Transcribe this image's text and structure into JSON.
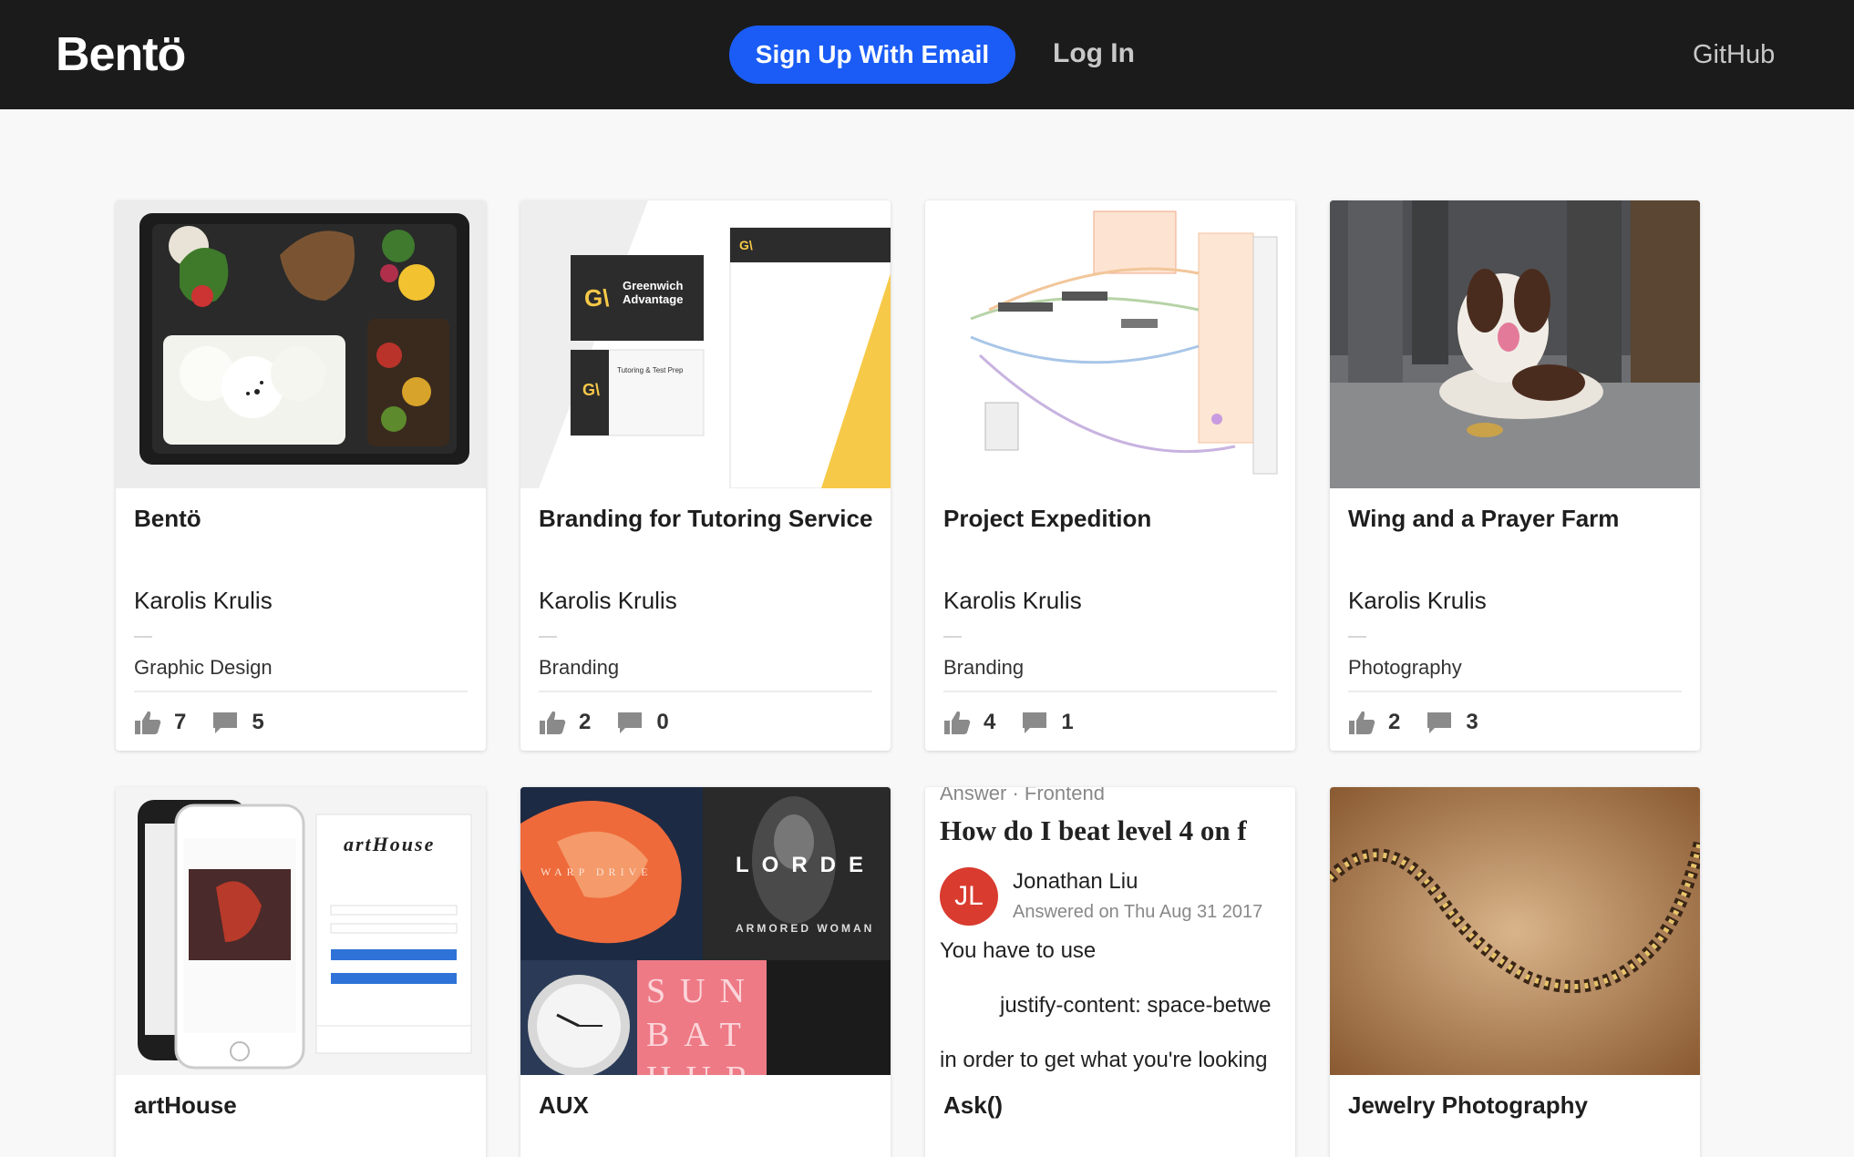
{
  "header": {
    "logo": "Bentö",
    "signup_label": "Sign Up With Email",
    "login_label": "Log In",
    "github_label": "GitHub"
  },
  "colors": {
    "header_bg": "#1b1b1b",
    "accent": "#1a5cf5",
    "page_bg": "#f8f8f8"
  },
  "cards": [
    {
      "title": "Bentö",
      "author": "Karolis Krulis",
      "category": "Graphic Design",
      "likes": "7",
      "comments": "5"
    },
    {
      "title": "Branding for Tutoring Service",
      "author": "Karolis Krulis",
      "category": "Branding",
      "likes": "2",
      "comments": "0"
    },
    {
      "title": "Project Expedition",
      "author": "Karolis Krulis",
      "category": "Branding",
      "likes": "4",
      "comments": "1"
    },
    {
      "title": "Wing and a Prayer Farm",
      "author": "Karolis Krulis",
      "category": "Photography",
      "likes": "2",
      "comments": "3"
    },
    {
      "title": "artHouse"
    },
    {
      "title": "AUX"
    },
    {
      "title": "Ask()"
    },
    {
      "title": "Jewelry Photography"
    }
  ],
  "thumb_text": {
    "brand_name": "Greenwich Advantage",
    "brand_tagline": "Tutoring & Test Prep",
    "arthouse_logo": "artHouse",
    "aux_artist": "LORDE",
    "aux_album": "ARMORED WOMAN",
    "aux_warp": "WARP DRIVE",
    "aux_sun": "SUN BAT HUR",
    "ask_answer": "Answer · Frontend",
    "ask_question": "How do I beat level 4 on f",
    "ask_avatar": "JL",
    "ask_name": "Jonathan Liu",
    "ask_date": "Answered on Thu Aug 31 2017",
    "ask_line1": "You have to use",
    "ask_line2": "justify-content: space-betwe",
    "ask_line3": "in order to get what you're looking"
  }
}
